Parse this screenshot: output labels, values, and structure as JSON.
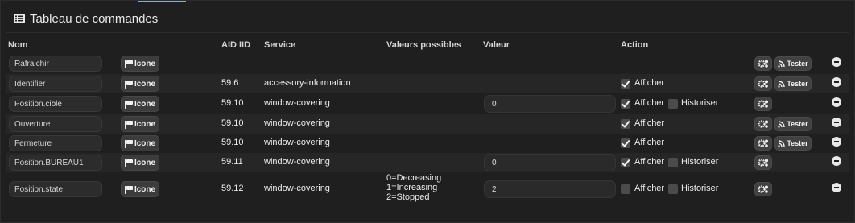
{
  "panel": {
    "title": "Tableau de commandes",
    "accent_color": "#94ca02"
  },
  "headers": {
    "nom": "Nom",
    "aid_iid": "AID IID",
    "service": "Service",
    "valeurs": "Valeurs possibles",
    "valeur": "Valeur",
    "action": "Action"
  },
  "labels": {
    "icone": "Icone",
    "afficher": "Afficher",
    "historiser": "Historiser",
    "tester": "Tester"
  },
  "rows": [
    {
      "name": "Rafraichir",
      "aid": "",
      "service": "",
      "possible": [],
      "value": null,
      "afficher": null,
      "historiser": null,
      "tester": true
    },
    {
      "name": "Identifier",
      "aid": "59.6",
      "service": "accessory-information",
      "possible": [],
      "value": null,
      "afficher": true,
      "historiser": null,
      "tester": true
    },
    {
      "name": "Position.cible",
      "aid": "59.10",
      "service": "window-covering",
      "possible": [],
      "value": "0",
      "afficher": true,
      "historiser": false,
      "tester": false
    },
    {
      "name": "Ouverture",
      "aid": "59.10",
      "service": "window-covering",
      "possible": [],
      "value": null,
      "afficher": true,
      "historiser": null,
      "tester": true
    },
    {
      "name": "Fermeture",
      "aid": "59.10",
      "service": "window-covering",
      "possible": [],
      "value": null,
      "afficher": true,
      "historiser": null,
      "tester": true
    },
    {
      "name": "Position.BUREAU1",
      "aid": "59.11",
      "service": "window-covering",
      "possible": [],
      "value": "0",
      "afficher": true,
      "historiser": false,
      "tester": false
    },
    {
      "name": "Position.state",
      "aid": "59.12",
      "service": "window-covering",
      "possible": [
        "0=Decreasing",
        "1=Increasing",
        "2=Stopped"
      ],
      "value": "2",
      "afficher": false,
      "historiser": false,
      "tester": false
    }
  ]
}
